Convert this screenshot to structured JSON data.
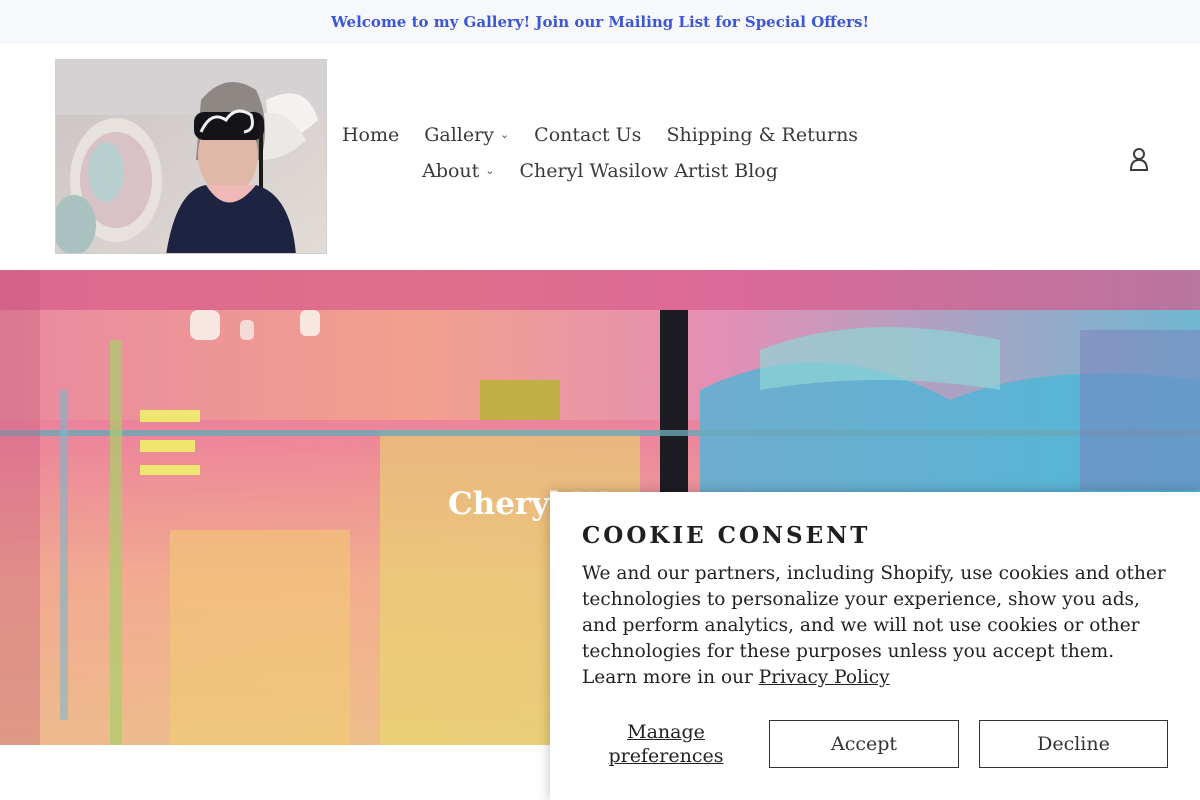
{
  "announcement": {
    "text": "Welcome to my Gallery! Join our Mailing List for Special Offers!"
  },
  "nav": {
    "row1": [
      {
        "label": "Home",
        "dropdown": false
      },
      {
        "label": "Gallery",
        "dropdown": true
      },
      {
        "label": "Contact Us",
        "dropdown": false
      },
      {
        "label": "Shipping & Returns",
        "dropdown": false
      }
    ],
    "row2": [
      {
        "label": "About",
        "dropdown": true
      },
      {
        "label": "Cheryl Wasilow Artist Blog",
        "dropdown": false
      }
    ],
    "chevron": "⌄"
  },
  "account": {
    "icon": "user-icon"
  },
  "hero": {
    "title": "Cheryl W"
  },
  "cookie": {
    "title": "COOKIE CONSENT",
    "body": "We and our partners, including Shopify, use cookies and other technologies to personalize your experience, show you ads, and perform analytics, and we will not use cookies or other technologies for these purposes unless you accept them. Learn more in our ",
    "link": "Privacy Policy",
    "manage_label": "Manage preferences",
    "accept_label": "Accept",
    "decline_label": "Decline"
  },
  "colors": {
    "announcement_text": "#3d56d3",
    "announcement_bg": "#f7f8fc"
  }
}
